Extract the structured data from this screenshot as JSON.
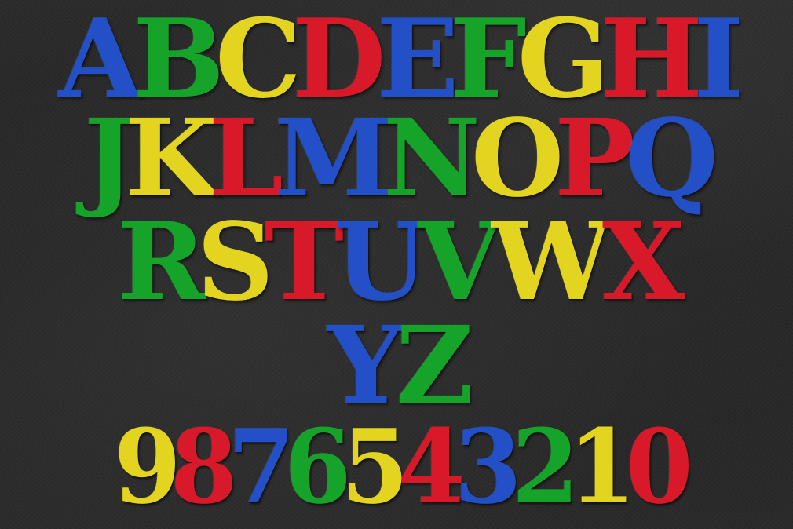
{
  "rows": [
    {
      "glyphs": [
        {
          "char": "A",
          "color": "#2350c6"
        },
        {
          "char": "B",
          "color": "#15a32a"
        },
        {
          "char": "C",
          "color": "#e3d51f"
        },
        {
          "char": "D",
          "color": "#d8192a"
        },
        {
          "char": "E",
          "color": "#2350c6"
        },
        {
          "char": "F",
          "color": "#15a32a"
        },
        {
          "char": "G",
          "color": "#e3d51f"
        },
        {
          "char": "H",
          "color": "#d8192a"
        },
        {
          "char": "I",
          "color": "#2350c6"
        }
      ]
    },
    {
      "glyphs": [
        {
          "char": "J",
          "color": "#15a32a"
        },
        {
          "char": "K",
          "color": "#e3d51f"
        },
        {
          "char": "L",
          "color": "#d8192a"
        },
        {
          "char": "M",
          "color": "#2350c6"
        },
        {
          "char": "N",
          "color": "#15a32a"
        },
        {
          "char": "O",
          "color": "#e3d51f"
        },
        {
          "char": "P",
          "color": "#d8192a"
        },
        {
          "char": "Q",
          "color": "#2350c6"
        }
      ]
    },
    {
      "glyphs": [
        {
          "char": "R",
          "color": "#15a32a"
        },
        {
          "char": "S",
          "color": "#e3d51f"
        },
        {
          "char": "T",
          "color": "#d8192a"
        },
        {
          "char": "U",
          "color": "#2350c6"
        },
        {
          "char": "V",
          "color": "#15a32a"
        },
        {
          "char": "W",
          "color": "#e3d51f"
        },
        {
          "char": "X",
          "color": "#d8192a"
        }
      ]
    },
    {
      "glyphs": [
        {
          "char": "Y",
          "color": "#2350c6"
        },
        {
          "char": "Z",
          "color": "#15a32a"
        }
      ]
    },
    {
      "glyphs": [
        {
          "char": "9",
          "color": "#e3d51f"
        },
        {
          "char": "8",
          "color": "#d8192a"
        },
        {
          "char": "7",
          "color": "#2350c6"
        },
        {
          "char": "6",
          "color": "#15a32a"
        },
        {
          "char": "5",
          "color": "#e3d51f"
        },
        {
          "char": "4",
          "color": "#d8192a"
        },
        {
          "char": "3",
          "color": "#2350c6"
        },
        {
          "char": "2",
          "color": "#15a32a"
        },
        {
          "char": "1",
          "color": "#e3d51f"
        },
        {
          "char": "0",
          "color": "#d8192a"
        }
      ]
    }
  ]
}
